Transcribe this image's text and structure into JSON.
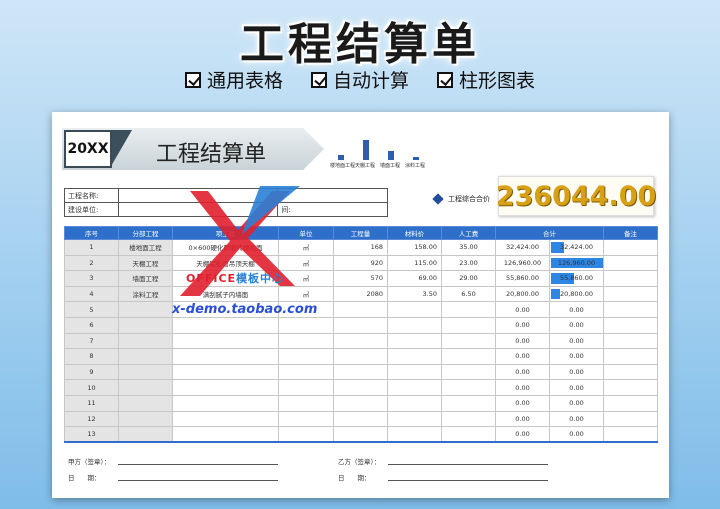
{
  "hero": {
    "title": "工程结算单",
    "features": [
      "通用表格",
      "自动计算",
      "柱形图表"
    ]
  },
  "banner": {
    "year": "20XX",
    "title": "工程结算单"
  },
  "mini_chart": {
    "labels": [
      "楼地面工程",
      "天棚工程",
      "墙面工程",
      "涂料工程"
    ],
    "values": [
      32424,
      126960,
      55860,
      20800
    ],
    "color": "#2e5fae"
  },
  "info": {
    "project_label": "工程名称:",
    "builder_label": "建设单位:",
    "builder_extra": "间:"
  },
  "total": {
    "label": "工程综合合价",
    "value": "236044.00",
    "color": "#d8a014"
  },
  "table": {
    "headers": [
      "序号",
      "分部工程",
      "",
      "单位",
      "工程量",
      "材料价",
      "人工费",
      "合计",
      "",
      "备注"
    ],
    "header_covered": "项工程",
    "rows": [
      {
        "no": "1",
        "part": "楼地面工程",
        "item": "0×600硬化耐磨砖楼地面",
        "unit": "㎡",
        "qty": "168",
        "mat": "158.00",
        "labor": "35.00",
        "total": "32,424.00",
        "total2": "32,424.00",
        "bar": 0.255
      },
      {
        "no": "2",
        "part": "天棚工程",
        "item": "天棚铝板面吊顶天棚",
        "unit": "㎡",
        "qty": "920",
        "mat": "115.00",
        "labor": "23.00",
        "total": "126,960.00",
        "total2": "126,960.00",
        "bar": 1.0
      },
      {
        "no": "3",
        "part": "墙面工程",
        "item": "",
        "unit": "㎡",
        "qty": "570",
        "mat": "69.00",
        "labor": "29.00",
        "total": "55,860.00",
        "total2": "55,860.00",
        "bar": 0.44
      },
      {
        "no": "4",
        "part": "涂料工程",
        "item": "满刮腻子内墙面",
        "unit": "㎡",
        "qty": "2080",
        "mat": "3.50",
        "labor": "6.50",
        "total": "20,800.00",
        "total2": "20,800.00",
        "bar": 0.164
      },
      {
        "no": "5",
        "part": "",
        "item": "",
        "unit": "",
        "qty": "",
        "mat": "",
        "labor": "",
        "total": "0.00",
        "total2": "0.00",
        "bar": 0
      },
      {
        "no": "6",
        "part": "",
        "item": "",
        "unit": "",
        "qty": "",
        "mat": "",
        "labor": "",
        "total": "0.00",
        "total2": "0.00",
        "bar": 0
      },
      {
        "no": "7",
        "part": "",
        "item": "",
        "unit": "",
        "qty": "",
        "mat": "",
        "labor": "",
        "total": "0.00",
        "total2": "0.00",
        "bar": 0
      },
      {
        "no": "8",
        "part": "",
        "item": "",
        "unit": "",
        "qty": "",
        "mat": "",
        "labor": "",
        "total": "0.00",
        "total2": "0.00",
        "bar": 0
      },
      {
        "no": "9",
        "part": "",
        "item": "",
        "unit": "",
        "qty": "",
        "mat": "",
        "labor": "",
        "total": "0.00",
        "total2": "0.00",
        "bar": 0
      },
      {
        "no": "10",
        "part": "",
        "item": "",
        "unit": "",
        "qty": "",
        "mat": "",
        "labor": "",
        "total": "0.00",
        "total2": "0.00",
        "bar": 0
      },
      {
        "no": "11",
        "part": "",
        "item": "",
        "unit": "",
        "qty": "",
        "mat": "",
        "labor": "",
        "total": "0.00",
        "total2": "0.00",
        "bar": 0
      },
      {
        "no": "12",
        "part": "",
        "item": "",
        "unit": "",
        "qty": "",
        "mat": "",
        "labor": "",
        "total": "0.00",
        "total2": "0.00",
        "bar": 0
      },
      {
        "no": "13",
        "part": "",
        "item": "",
        "unit": "",
        "qty": "",
        "mat": "",
        "labor": "",
        "total": "0.00",
        "total2": "0.00",
        "bar": 0
      }
    ],
    "bar_color": "#2d86e3"
  },
  "signature": {
    "party_a": "甲方（签章）：",
    "party_b": "乙方（签章）：",
    "date_a": "日　　期：",
    "date_b": "日　　期："
  },
  "watermark": {
    "brand_red": "OFFICE",
    "brand_blue": "模板中心",
    "url": "x-demo.taobao.com"
  }
}
